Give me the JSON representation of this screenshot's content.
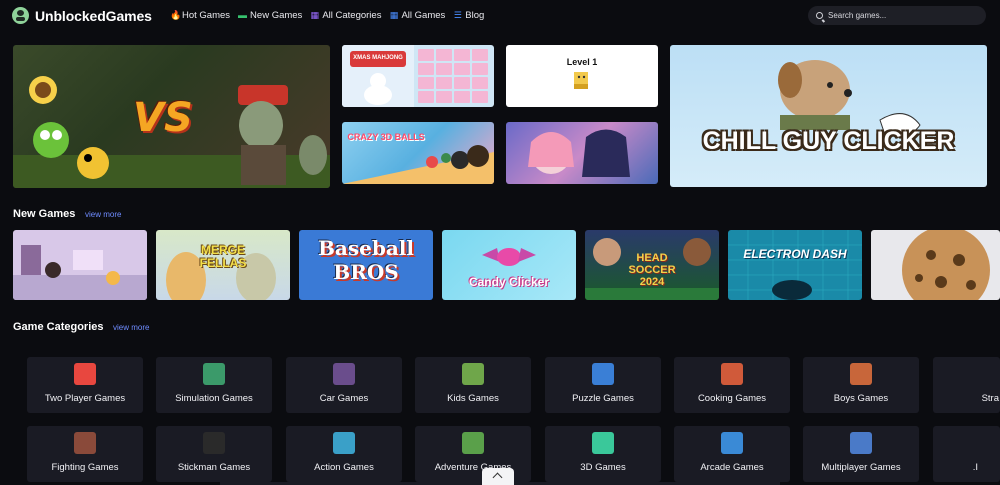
{
  "header": {
    "logo_text": "UnblockedGames",
    "nav": [
      {
        "label": "Hot Games",
        "icon": "flame-icon",
        "color": "#ff6a2b"
      },
      {
        "label": "New Games",
        "icon": "gamepad-icon",
        "color": "#37c26f"
      },
      {
        "label": "All Categories",
        "icon": "grid-icon",
        "color": "#9b6bff"
      },
      {
        "label": "All Games",
        "icon": "apps-icon",
        "color": "#4a8dff"
      },
      {
        "label": "Blog",
        "icon": "list-icon",
        "color": "#4a8dff"
      }
    ],
    "search_placeholder": "Search games..."
  },
  "featured": [
    {
      "title": "VS",
      "icon": "plants-vs-zombies-thumbnail"
    },
    {
      "title": "XMAS MAHJONG",
      "icon": "mahjong-thumbnail"
    },
    {
      "title": "Level 1",
      "icon": "level-thumbnail"
    },
    {
      "title": "CRAZY 3D BALLS",
      "icon": "balls-thumbnail"
    },
    {
      "title": "",
      "icon": "anime-girls-thumbnail"
    },
    {
      "title": "CHILL GUY CLICKER",
      "icon": "chill-guy-thumbnail"
    }
  ],
  "new_games": {
    "title": "New Games",
    "view_more": "view more",
    "items": [
      {
        "title": "",
        "icon": "room-thumbnail"
      },
      {
        "title": "MERGE FELLAS",
        "icon": "merge-fellas-thumbnail"
      },
      {
        "title": "Baseball BROS",
        "icon": "baseball-bros-thumbnail"
      },
      {
        "title": "Candy Clicker",
        "icon": "candy-clicker-thumbnail"
      },
      {
        "title": "HEAD SOCCER 2024",
        "icon": "head-soccer-thumbnail"
      },
      {
        "title": "ELECTRON DASH",
        "icon": "electron-dash-thumbnail"
      },
      {
        "title": "",
        "icon": "cookie-thumbnail"
      }
    ]
  },
  "categories": {
    "title": "Game Categories",
    "view_more": "view more",
    "row1": [
      {
        "label": "Two Player Games",
        "color": "#e8473f"
      },
      {
        "label": "Simulation Games",
        "color": "#3b9a6a"
      },
      {
        "label": "Car Games",
        "color": "#6a4d8c"
      },
      {
        "label": "Kids Games",
        "color": "#6fa64a"
      },
      {
        "label": "Puzzle Games",
        "color": "#3a7fd6"
      },
      {
        "label": "Cooking Games",
        "color": "#d05a3a"
      },
      {
        "label": "Boys Games",
        "color": "#c8663a"
      },
      {
        "label": "Stra",
        "color": "#5a5a7a"
      }
    ],
    "row2": [
      {
        "label": "Fighting Games",
        "color": "#8a4a3a"
      },
      {
        "label": "Stickman Games",
        "color": "#2a2a2a"
      },
      {
        "label": "Action Games",
        "color": "#3aa0c8"
      },
      {
        "label": "Adventure Games",
        "color": "#5aa04a"
      },
      {
        "label": "3D Games",
        "color": "#3ac89a"
      },
      {
        "label": "Arcade Games",
        "color": "#3a8ad6"
      },
      {
        "label": "Multiplayer Games",
        "color": "#4a7ac8"
      },
      {
        "label": ".I",
        "color": "#5a5a7a"
      }
    ]
  }
}
